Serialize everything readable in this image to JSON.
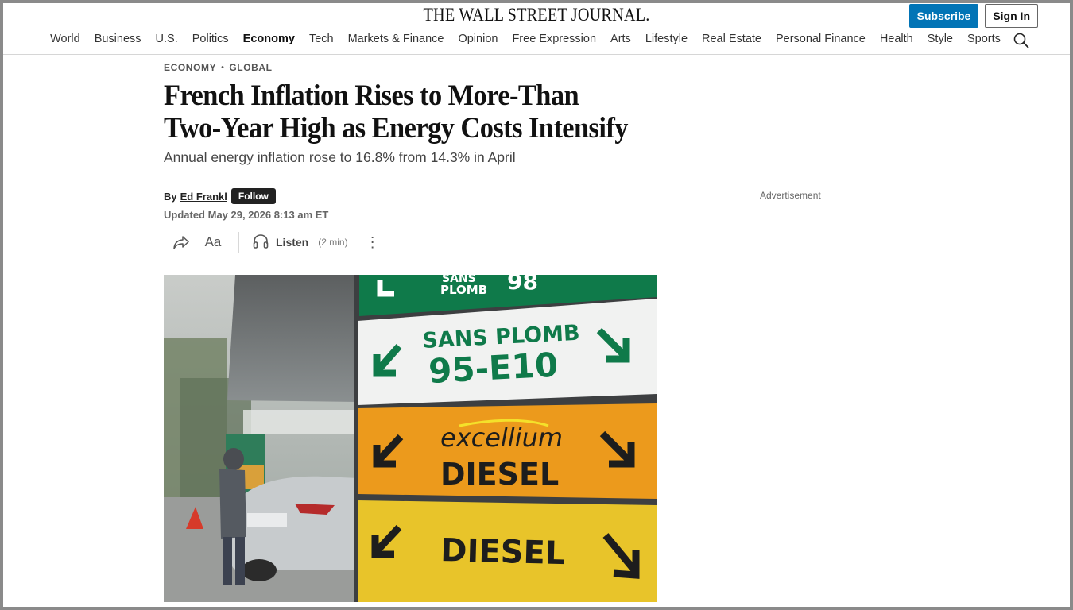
{
  "header": {
    "masthead": "THE WALL STREET JOURNAL.",
    "subscribe_label": "Subscribe",
    "signin_label": "Sign In"
  },
  "nav": {
    "items": [
      "World",
      "Business",
      "U.S.",
      "Politics",
      "Economy",
      "Tech",
      "Markets & Finance",
      "Opinion",
      "Free Expression",
      "Arts",
      "Lifestyle",
      "Real Estate",
      "Personal Finance",
      "Health",
      "Style",
      "Sports"
    ],
    "active": "Economy",
    "search_icon": "search-icon"
  },
  "article": {
    "kicker_1": "ECONOMY",
    "kicker_sep": "•",
    "kicker_2": "GLOBAL",
    "headline": "French Inflation Rises to More-Than Two-Year High as Energy Costs Intensify",
    "dek": "Annual energy inflation rose to 16.8% from 14.3% in April",
    "by_label": "By",
    "author": "Ed Frankl",
    "follow_label": "Follow",
    "updated": "Updated May 29, 2026 8:13 am ET"
  },
  "tools": {
    "share_icon": "share-icon",
    "text_size_label": "Aa",
    "listen_icon": "headphones-icon",
    "listen_label": "Listen",
    "listen_duration": "(2 min)",
    "more_label": "⋮"
  },
  "sidebar": {
    "ad_label": "Advertisement"
  },
  "photo": {
    "sign_1_line1": "SANS",
    "sign_1_line2": "PLOMB",
    "sign_1_number": "98",
    "sign_2_line1": "SANS PLOMB",
    "sign_2_line2": "95-E10",
    "sign_3_brand": "excellium",
    "sign_3_line": "DIESEL",
    "sign_4_line": "DIESEL",
    "colors": {
      "green": "#0f7a4a",
      "orange": "#ec9a1c",
      "yellow": "#e8c42a"
    }
  }
}
